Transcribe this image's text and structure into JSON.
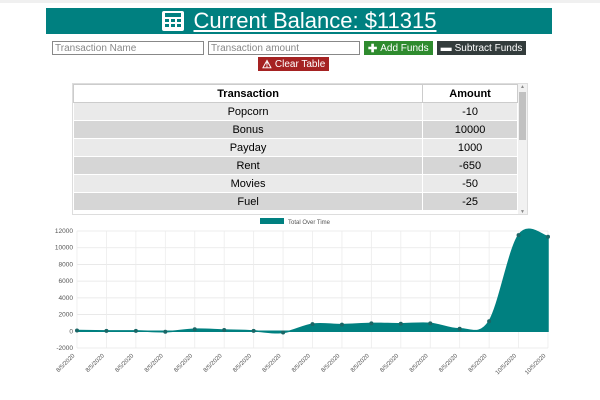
{
  "header": {
    "title": "Current Balance: $11315",
    "icon": "calculator-icon"
  },
  "form": {
    "name_placeholder": "Transaction Name",
    "amount_placeholder": "Transaction amount",
    "add_label": "Add Funds",
    "subtract_label": "Subtract Funds",
    "clear_label": "Clear Table"
  },
  "table": {
    "columns": [
      "Transaction",
      "Amount"
    ],
    "rows": [
      [
        "Popcorn",
        "-10"
      ],
      [
        "Bonus",
        "10000"
      ],
      [
        "Payday",
        "1000"
      ],
      [
        "Rent",
        "-650"
      ],
      [
        "Movies",
        "-50"
      ],
      [
        "Fuel",
        "-25"
      ]
    ]
  },
  "chart_data": {
    "type": "area",
    "legend": [
      "Total Over Time"
    ],
    "legend_position": "top",
    "color": "#008080",
    "ylim": [
      -2000,
      12000
    ],
    "yticks": [
      -2000,
      0,
      2000,
      4000,
      6000,
      8000,
      10000,
      12000
    ],
    "x": [
      "8/5/2020",
      "8/5/2020",
      "8/5/2020",
      "8/5/2020",
      "8/5/2020",
      "8/5/2020",
      "8/5/2020",
      "8/5/2020",
      "8/5/2020",
      "8/5/2020",
      "8/5/2020",
      "8/5/2020",
      "8/5/2020",
      "8/5/2020",
      "8/5/2020",
      "10/5/2020",
      "10/5/2020"
    ],
    "values": [
      100,
      50,
      50,
      -50,
      250,
      150,
      50,
      -150,
      850,
      800,
      950,
      900,
      950,
      300,
      1200,
      11500,
      11315
    ],
    "grid": true
  }
}
